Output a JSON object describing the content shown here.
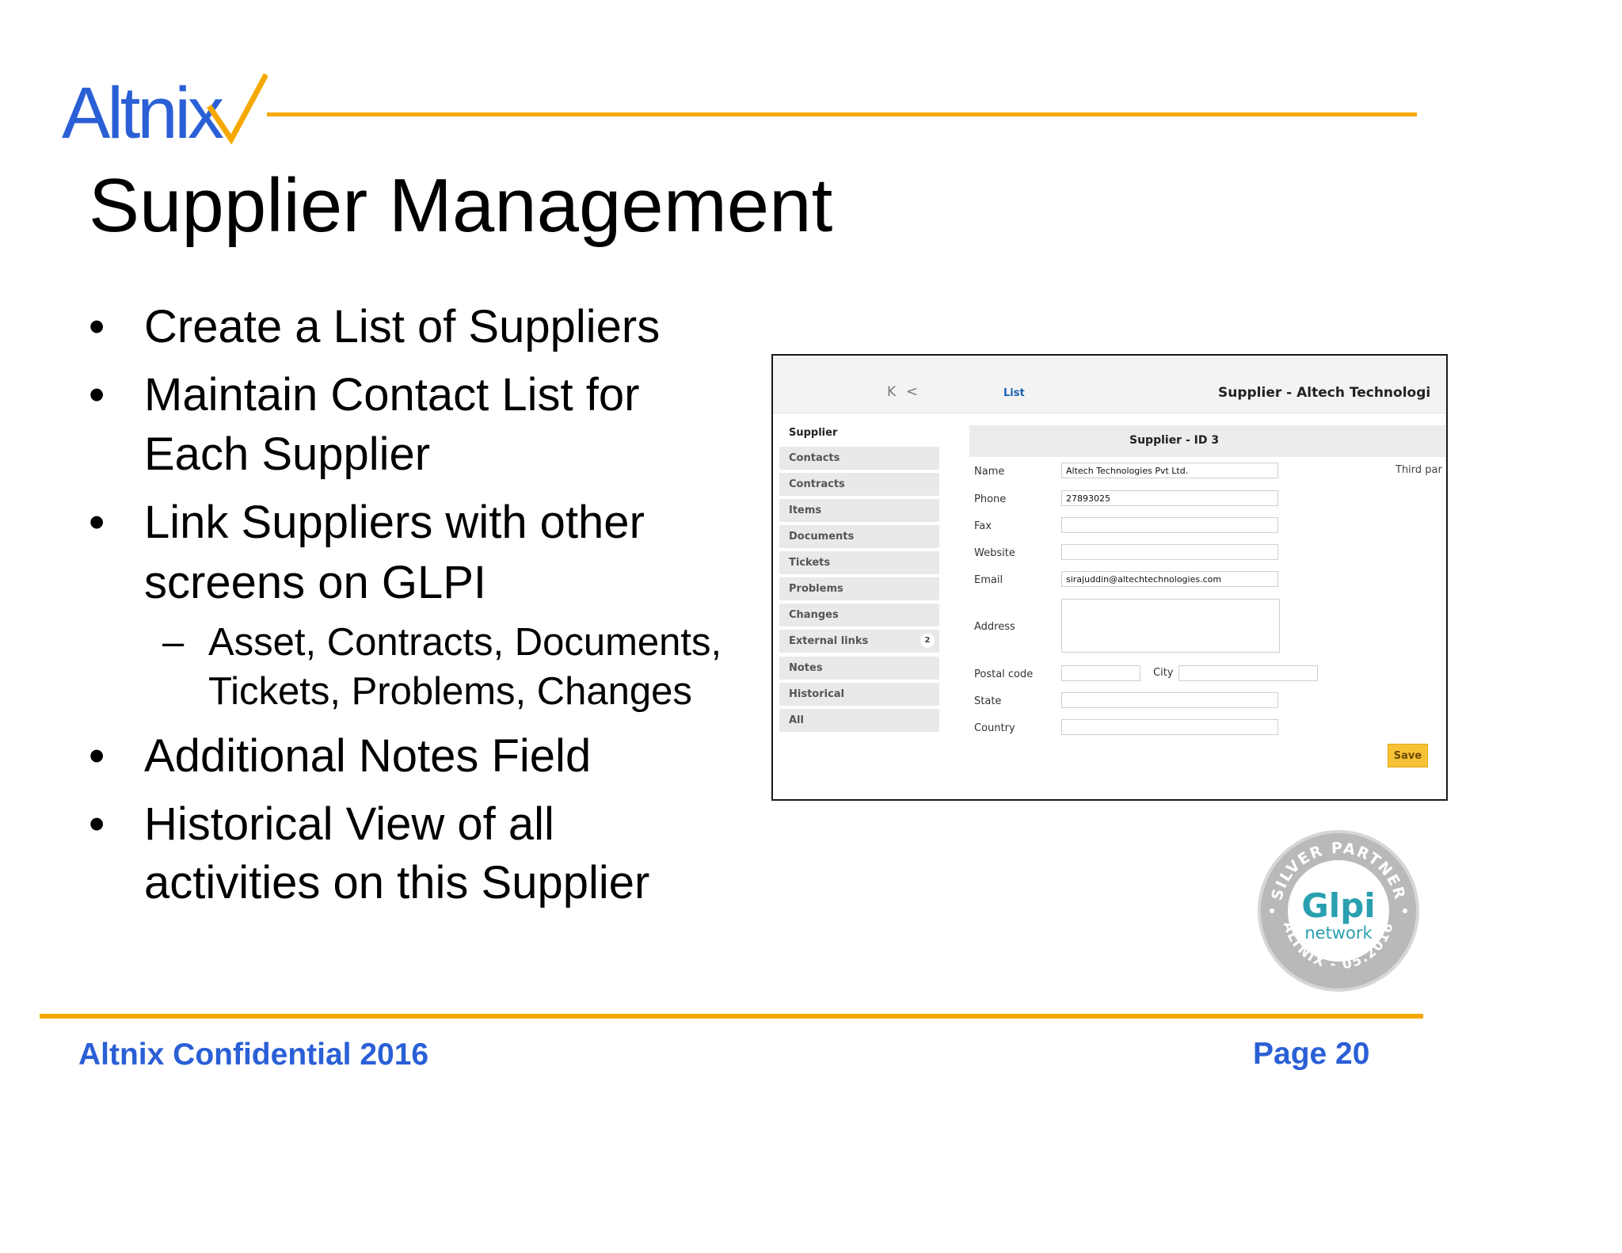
{
  "logo": {
    "text": "Altnix",
    "accent_color": "#f5a800",
    "brand_color": "#2a5fd6"
  },
  "slide": {
    "title": "Supplier Management",
    "bullets": [
      {
        "lines": [
          "Create a List of Suppliers"
        ]
      },
      {
        "lines": [
          "Maintain Contact List for",
          "Each Supplier"
        ]
      },
      {
        "lines": [
          "Link Suppliers with other",
          "screens on GLPI"
        ],
        "sub": {
          "lines": [
            "Asset, Contracts, Documents,",
            "Tickets, Problems, Changes"
          ]
        }
      },
      {
        "lines": [
          "Additional Notes Field"
        ]
      },
      {
        "lines": [
          "Historical View of all",
          "activities on this Supplier"
        ]
      }
    ],
    "bullet_symbol": "•",
    "dash_symbol": "–"
  },
  "screenshot": {
    "nav_first": "K",
    "nav_prev": "<",
    "list_link": "List",
    "title": "Supplier - Altech Technologi",
    "sidebar": {
      "heading": "Supplier",
      "items": [
        "Contacts",
        "Contracts",
        "Items",
        "Documents",
        "Tickets",
        "Problems",
        "Changes",
        "External links",
        "Notes",
        "Historical",
        "All"
      ],
      "external_links_count": "2"
    },
    "form": {
      "header": "Supplier - ID 3",
      "name_label": "Name",
      "name_value": "Altech Technologies Pvt Ltd.",
      "phone_label": "Phone",
      "phone_value": "27893025",
      "fax_label": "Fax",
      "fax_value": "",
      "website_label": "Website",
      "website_value": "",
      "email_label": "Email",
      "email_value": "sirajuddin@altechtechnologies.com",
      "address_label": "Address",
      "address_value": "",
      "postal_label": "Postal code",
      "postal_value": "",
      "city_label": "City",
      "city_value": "",
      "state_label": "State",
      "state_value": "",
      "country_label": "Country",
      "country_value": "",
      "third_party_label": "Third par",
      "save_label": "Save"
    }
  },
  "badge": {
    "top_text": "SILVER PARTNER",
    "logo_text": "Glpi",
    "sub_text": "network",
    "bottom_text": "ALTNIX - 05.2016"
  },
  "footer": {
    "left": "Altnix Confidential 2016",
    "right": "Page 20"
  }
}
